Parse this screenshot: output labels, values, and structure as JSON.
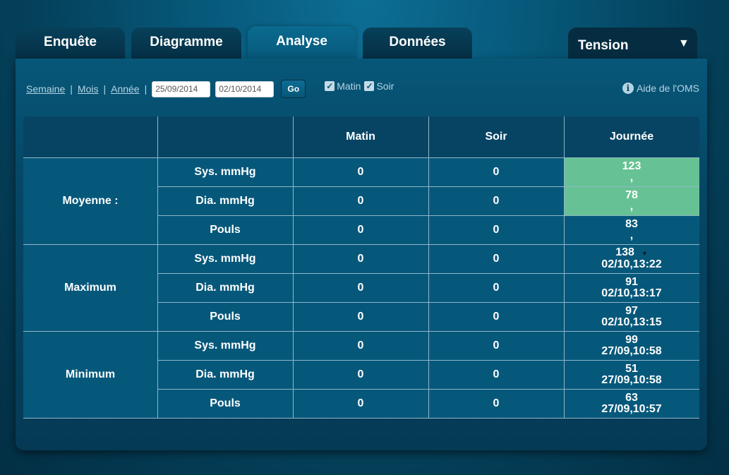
{
  "tabs": [
    {
      "label": "Enquête"
    },
    {
      "label": "Diagramme"
    },
    {
      "label": "Analyse"
    },
    {
      "label": "Données"
    }
  ],
  "type_select": {
    "value": "Tension"
  },
  "toolbar": {
    "week": "Semaine",
    "month": "Mois",
    "year": "Année",
    "separator": "|",
    "date_from": "25/09/2014",
    "date_to": "02/10/2014",
    "go": "Go",
    "morning": "Matin",
    "evening": "Soir",
    "help": "Aide de l'OMS"
  },
  "table": {
    "columns": [
      "Matin",
      "Soir",
      "Journée"
    ],
    "groups": [
      {
        "label": "Moyenne :",
        "rows": [
          {
            "metric": "Sys. mmHg",
            "matin": "0",
            "soir": "0",
            "day_value": "123",
            "day_sub": ","
          },
          {
            "metric": "Dia. mmHg",
            "matin": "0",
            "soir": "0",
            "day_value": "78",
            "day_sub": ","
          },
          {
            "metric": "Pouls",
            "matin": "0",
            "soir": "0",
            "day_value": "83",
            "day_sub": ","
          }
        ]
      },
      {
        "label": "Maximum",
        "rows": [
          {
            "metric": "Sys. mmHg",
            "matin": "0",
            "soir": "0",
            "day_value": "138",
            "day_sub": "02/10,13:22"
          },
          {
            "metric": "Dia. mmHg",
            "matin": "0",
            "soir": "0",
            "day_value": "91",
            "day_sub": "02/10,13:17"
          },
          {
            "metric": "Pouls",
            "matin": "0",
            "soir": "0",
            "day_value": "97",
            "day_sub": "02/10,13:15"
          }
        ]
      },
      {
        "label": "Minimum",
        "rows": [
          {
            "metric": "Sys. mmHg",
            "matin": "0",
            "soir": "0",
            "day_value": "99",
            "day_sub": "27/09,10:58"
          },
          {
            "metric": "Dia. mmHg",
            "matin": "0",
            "soir": "0",
            "day_value": "51",
            "day_sub": "27/09,10:58"
          },
          {
            "metric": "Pouls",
            "matin": "0",
            "soir": "0",
            "day_value": "63",
            "day_sub": "27/09,10:57"
          }
        ]
      }
    ]
  },
  "colors": {
    "highlight": "#66c294"
  }
}
